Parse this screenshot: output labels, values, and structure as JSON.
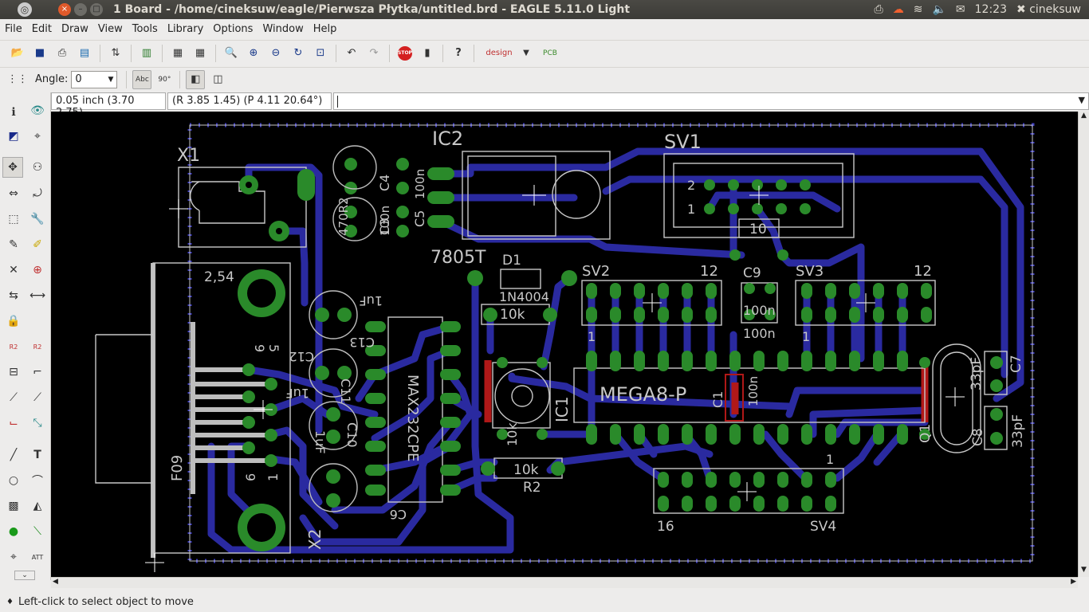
{
  "window": {
    "title": "1 Board - /home/cineksuw/eagle/Pierwsza Płytka/untitled.brd - EAGLE 5.11.0 Light",
    "clock": "12:23",
    "user": "cineksuw"
  },
  "menu": [
    "File",
    "Edit",
    "Draw",
    "View",
    "Tools",
    "Library",
    "Options",
    "Window",
    "Help"
  ],
  "toolbar2": {
    "angle_label": "Angle:",
    "angle_value": "0"
  },
  "coords": {
    "grid": "0.05 inch (3.70 2.75)",
    "polar": "(R 3.85 1.45) (P 4.11 20.64°)"
  },
  "status": "Left-click to select object to move",
  "board": {
    "labels": {
      "x1": "X1",
      "ic2": "IC2",
      "sv1": "SV1",
      "c4": "C4",
      "c3": "C3",
      "c5": "C5",
      "r2a": "470R2",
      "c100a": "100n",
      "c100b": "100n",
      "val7805": "7805T",
      "d1": "D1",
      "d1val": "1N4004",
      "r10k": "10k",
      "sv2": "SV2",
      "sv2n12": "12",
      "sv2n1": "1",
      "c9": "C9",
      "c9val": "100n",
      "c9val2": "100n",
      "sv3": "SV3",
      "sv3n12": "12",
      "sv3n1": "1",
      "sv1n2": "2",
      "sv1n1": "1",
      "sv1n10": "10",
      "x2lbl": "2,54",
      "uf1": "1uF",
      "c12": "C12",
      "uf2": "1uF",
      "c11": "C11",
      "c10": "C10",
      "uf3": "1uF",
      "max": "MAX232CPE",
      "c6": "C6",
      "n9": "9",
      "n5": "5",
      "n6": "6",
      "n1": "1",
      "f09": "F09",
      "x2": "X2",
      "mega": "MEGA8-P",
      "ic1": "IC1",
      "c1": "C1",
      "c1val": "100n",
      "c7": "C7",
      "c8": "C8",
      "pf1": "33pF",
      "pf2": "33pF",
      "q1": "Q1",
      "r2": "R2",
      "r2val": "10k",
      "sv4": "SV4",
      "sv4n16": "16",
      "sv4n1": "1",
      "c13": "C13",
      "r": "10k"
    }
  }
}
